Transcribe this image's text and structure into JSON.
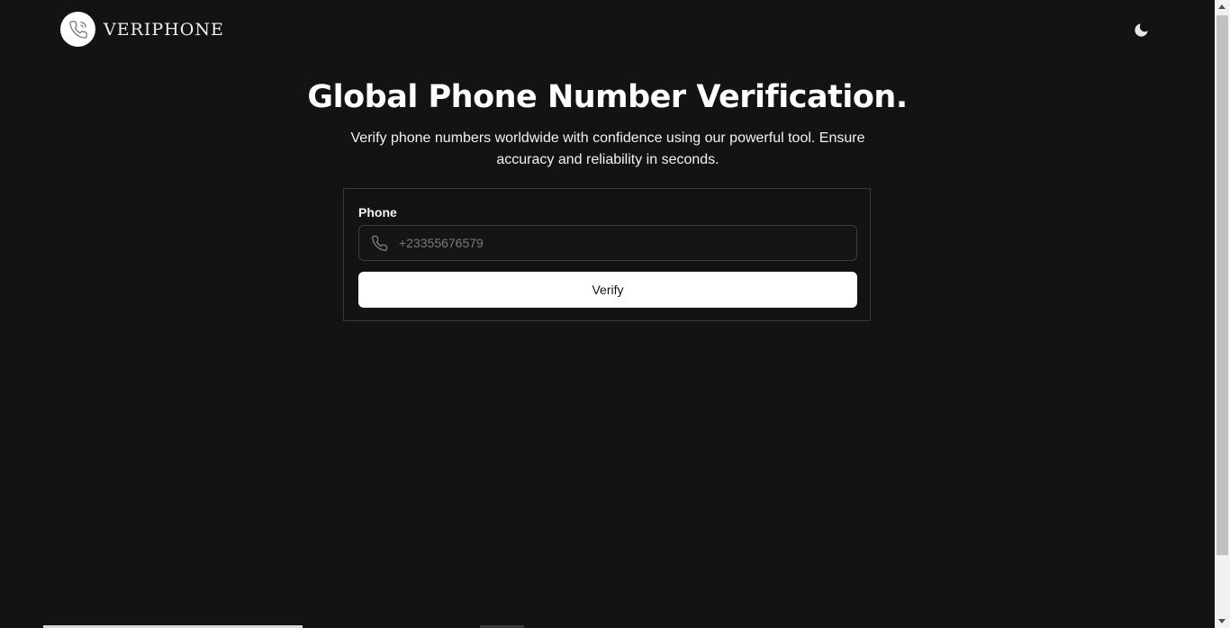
{
  "header": {
    "brand": "VERIPHONE",
    "logo_icon": "phone-outline-icon",
    "theme_toggle_icon": "moon-icon"
  },
  "hero": {
    "title": "Global Phone Number Verification.",
    "subtitle": "Verify phone numbers worldwide with confidence using our powerful tool. Ensure accuracy and reliability in seconds."
  },
  "form": {
    "phone_label": "Phone",
    "phone_placeholder": "+23355676579",
    "phone_value": "",
    "phone_icon": "phone-icon",
    "verify_label": "Verify"
  },
  "colors": {
    "background": "#131313",
    "text": "#ffffff",
    "button_bg": "#ffffff",
    "button_text": "#111111",
    "border": "#3a3a3a"
  }
}
